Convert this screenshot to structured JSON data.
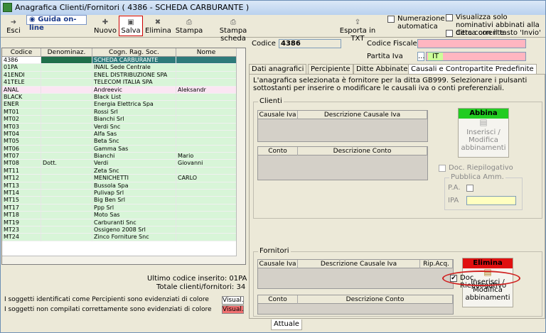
{
  "window": {
    "title": "Anagrafica Clienti/Fornitori ( 4386 - SCHEDA CARBURANTE )"
  },
  "toolbar": {
    "esci": "Esci",
    "guida": "Guida on-line",
    "nuovo": "Nuovo",
    "salva": "Salva",
    "elimina": "Elimina",
    "stampa": "Stampa",
    "stampa_scheda": "Stampa scheda",
    "esporta": "Esporta in TXT"
  },
  "options": {
    "numerazione": "Numerazione automatica",
    "visualizza": "Visualizza solo nominativi abbinati alla ditta corrente",
    "cerca": "Cerca con il tasto 'Invio'"
  },
  "grid": {
    "columns": [
      "Codice",
      "Denominaz.",
      "Cogn. Rag. Soc.",
      "Nome"
    ],
    "rows": [
      [
        "4386",
        "",
        "SCHEDA CARBURANTE",
        ""
      ],
      [
        "01PA",
        "",
        "INAIL Sede Centrale",
        ""
      ],
      [
        "41ENDI",
        "",
        "ENEL DISTRIBUZIONE SPA",
        ""
      ],
      [
        "41TELE",
        "",
        "TELECOM ITALIA SPA",
        ""
      ],
      [
        "ANAL",
        "",
        "Andreevic",
        "Aleksandr"
      ],
      [
        "BLACK",
        "",
        "Black List",
        ""
      ],
      [
        "ENER",
        "",
        "Energia Elettrica Spa",
        ""
      ],
      [
        "MT01",
        "",
        "Rossi Srl",
        ""
      ],
      [
        "MT02",
        "",
        "Bianchi Srl",
        ""
      ],
      [
        "MT03",
        "",
        "Verdi Snc",
        ""
      ],
      [
        "MT04",
        "",
        "Alfa Sas",
        ""
      ],
      [
        "MT05",
        "",
        "Beta Snc",
        ""
      ],
      [
        "MT06",
        "",
        "Gamma Sas",
        ""
      ],
      [
        "MT07",
        "",
        "Bianchi",
        "Mario"
      ],
      [
        "MT08",
        "Dott.",
        "Verdi",
        "Giovanni"
      ],
      [
        "MT11",
        "",
        "Zeta Snc",
        ""
      ],
      [
        "MT12",
        "",
        "MENICHETTI",
        "CARLO"
      ],
      [
        "MT13",
        "",
        "Bussola Spa",
        ""
      ],
      [
        "MT14",
        "",
        "Pulivap Srl",
        ""
      ],
      [
        "MT15",
        "",
        "Big Ben Srl",
        ""
      ],
      [
        "MT17",
        "",
        "Ppp Srl",
        ""
      ],
      [
        "MT18",
        "",
        "Moto Sas",
        ""
      ],
      [
        "MT19",
        "",
        "Carburanti Snc",
        ""
      ],
      [
        "MT23",
        "",
        "Ossigeno 2008 Srl",
        ""
      ],
      [
        "MT24",
        "",
        "Zinco Forniture Snc",
        ""
      ]
    ]
  },
  "status": {
    "ultimo_codice": "Ultimo codice inserito: 01PA",
    "totale": "Totale clienti/fornitori: 34",
    "percipienti_note": "I soggetti identificati come Percipienti sono evidenziati di colore",
    "noncompilati_note": "I soggetti non compilati correttamente sono evidenziati di colore",
    "visual1": "Visual.",
    "visual2": "Visual."
  },
  "detail": {
    "codice_label": "Codice",
    "codice_value": "4386",
    "cf_label": "Codice Fiscale",
    "piva_label": "Partita Iva",
    "piva_btn": "...",
    "piva_country": "IT",
    "tabs": [
      "Dati anagrafici",
      "Percipiente",
      "Ditte Abbinate",
      "Causali e Contropartite Predefinite"
    ],
    "note": "L'anagrafica selezionata è fornitore per la ditta GB999. Selezionare i pulsanti sottostanti per inserire o modificare le causali iva o conti preferenziali.",
    "clienti": {
      "title": "Clienti",
      "causale_cols": [
        "Causale Iva",
        "Descrizione Causale Iva"
      ],
      "conto_cols": [
        "Conto",
        "Descrizione Conto"
      ],
      "abbina": "Abbina",
      "inserisci": "Inserisci / Modifica abbinamenti",
      "doc_riep": "Doc. Riepilogativo",
      "pubblica": "Pubblica Amm.",
      "pa": "P.A.",
      "ipa": "IPA"
    },
    "fornitori": {
      "title": "Fornitori",
      "causale_cols": [
        "Causale Iva",
        "Descrizione Causale Iva",
        "Rip.Acq."
      ],
      "conto_cols": [
        "Conto",
        "Descrizione Conto"
      ],
      "elimina": "Elimina",
      "inserisci": "Inserisci / Modifica abbinamenti",
      "doc_riep": "Doc. Riepilogativo"
    }
  },
  "bottom_tab": "Attuale",
  "colors": {
    "row_green": "#d8f5d8",
    "row_selected": "#2e7a7a",
    "row_pink": "#fbe6f3",
    "pink_field": "#ffb6c1",
    "green_btn": "#22cc22",
    "red_btn": "#e01010",
    "yellow_field": "#ffffc0"
  }
}
